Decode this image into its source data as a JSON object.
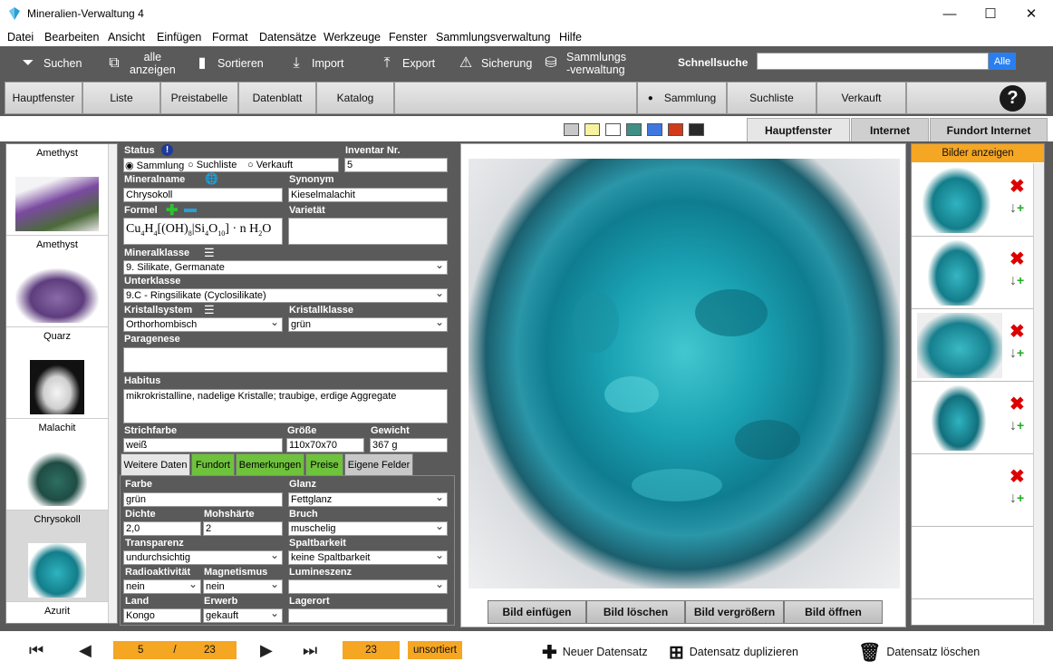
{
  "window": {
    "title": "Mineralien-Verwaltung 4"
  },
  "menu": [
    "Datei",
    "Bearbeiten",
    "Ansicht",
    "Einfügen",
    "Format",
    "Datensätze",
    "Werkzeuge",
    "Fenster",
    "Sammlungsverwaltung",
    "Hilfe"
  ],
  "toolbar": {
    "suchen": "Suchen",
    "alle_line1": "alle",
    "alle_line2": "anzeigen",
    "sortieren": "Sortieren",
    "import": "Import",
    "export": "Export",
    "sicherung": "Sicherung",
    "samm_line1": "Sammlungs",
    "samm_line2": "-verwaltung",
    "schnellsuche": "Schnellsuche",
    "alle_btn": "Alle"
  },
  "nav": {
    "hauptfenster": "Hauptfenster",
    "liste": "Liste",
    "preistabelle": "Preistabelle",
    "datenblatt": "Datenblatt",
    "katalog": "Katalog",
    "sammlung": "Sammlung",
    "suchliste": "Suchliste",
    "verkauft": "Verkauft",
    "help": "?"
  },
  "swatches": [
    "#c8c8c8",
    "#f7f1a0",
    "#ffffff",
    "#3f8f86",
    "#3f77e0",
    "#d23a1a",
    "#2a2a2a"
  ],
  "top_tabs": {
    "hauptfenster": "Hauptfenster",
    "internet": "Internet",
    "fundort": "Fundort Internet"
  },
  "list_items": [
    {
      "name": "Amethyst"
    },
    {
      "name": "Amethyst"
    },
    {
      "name": "Quarz"
    },
    {
      "name": "Malachit"
    },
    {
      "name": "Chrysokoll"
    },
    {
      "name": "Azurit"
    }
  ],
  "form": {
    "status_label": "Status",
    "status_options": [
      "Sammlung",
      "Suchliste",
      "Verkauft"
    ],
    "inventar_label": "Inventar Nr.",
    "inventar": "5",
    "mineralname_label": "Mineralname",
    "mineralname": "Chrysokoll",
    "synonym_label": "Synonym",
    "synonym": "Kieselmalachit",
    "formel_label": "Formel",
    "varietaet_label": "Varietät",
    "mineralklasse_label": "Mineralklasse",
    "mineralklasse": "9. Silikate, Germanate",
    "unterklasse_label": "Unterklasse",
    "unterklasse": "9.C - Ringsilikate (Cyclosilikate)",
    "kristallsystem_label": "Kristallsystem",
    "kristallsystem": "Orthorhombisch",
    "kristallklasse_label": "Kristallklasse",
    "kristallklasse": "grün",
    "paragenese_label": "Paragenese",
    "habitus_label": "Habitus",
    "habitus": "mikrokristalline, nadelige Kristalle; traubige, erdige Aggregate",
    "strichfarbe_label": "Strichfarbe",
    "strichfarbe": "weiß",
    "groesse_label": "Größe",
    "groesse": "110x70x70",
    "gewicht_label": "Gewicht",
    "gewicht": "367 g"
  },
  "subtabs": [
    "Weitere Daten",
    "Fundort",
    "Bemerkungen",
    "Preise",
    "Eigene Felder"
  ],
  "details": {
    "farbe_label": "Farbe",
    "farbe": "grün",
    "glanz_label": "Glanz",
    "glanz": "Fettglanz",
    "dichte_label": "Dichte",
    "dichte": "2,0",
    "mohs_label": "Mohshärte",
    "mohs": "2",
    "bruch_label": "Bruch",
    "bruch": "muschelig",
    "transparenz_label": "Transparenz",
    "transparenz": "undurchsichtig",
    "spaltbarkeit_label": "Spaltbarkeit",
    "spaltbarkeit": "keine Spaltbarkeit",
    "radio_label": "Radioaktivität",
    "radio": "nein",
    "magnet_label": "Magnetismus",
    "magnet": "nein",
    "lumin_label": "Lumineszenz",
    "lumin": "",
    "land_label": "Land",
    "land": "Kongo",
    "erwerb_label": "Erwerb",
    "erwerb": "gekauft",
    "lagerort_label": "Lagerort",
    "lagerort": ""
  },
  "photo_buttons": [
    "Bild einfügen",
    "Bild löschen",
    "Bild vergrößern",
    "Bild öffnen"
  ],
  "right": {
    "bilder_btn": "Bilder anzeigen"
  },
  "footer": {
    "current": "5",
    "sep": "/",
    "total": "23",
    "count": "23",
    "sort": "unsortiert",
    "neu": "Neuer Datensatz",
    "dup": "Datensatz duplizieren",
    "del": "Datensatz löschen"
  }
}
